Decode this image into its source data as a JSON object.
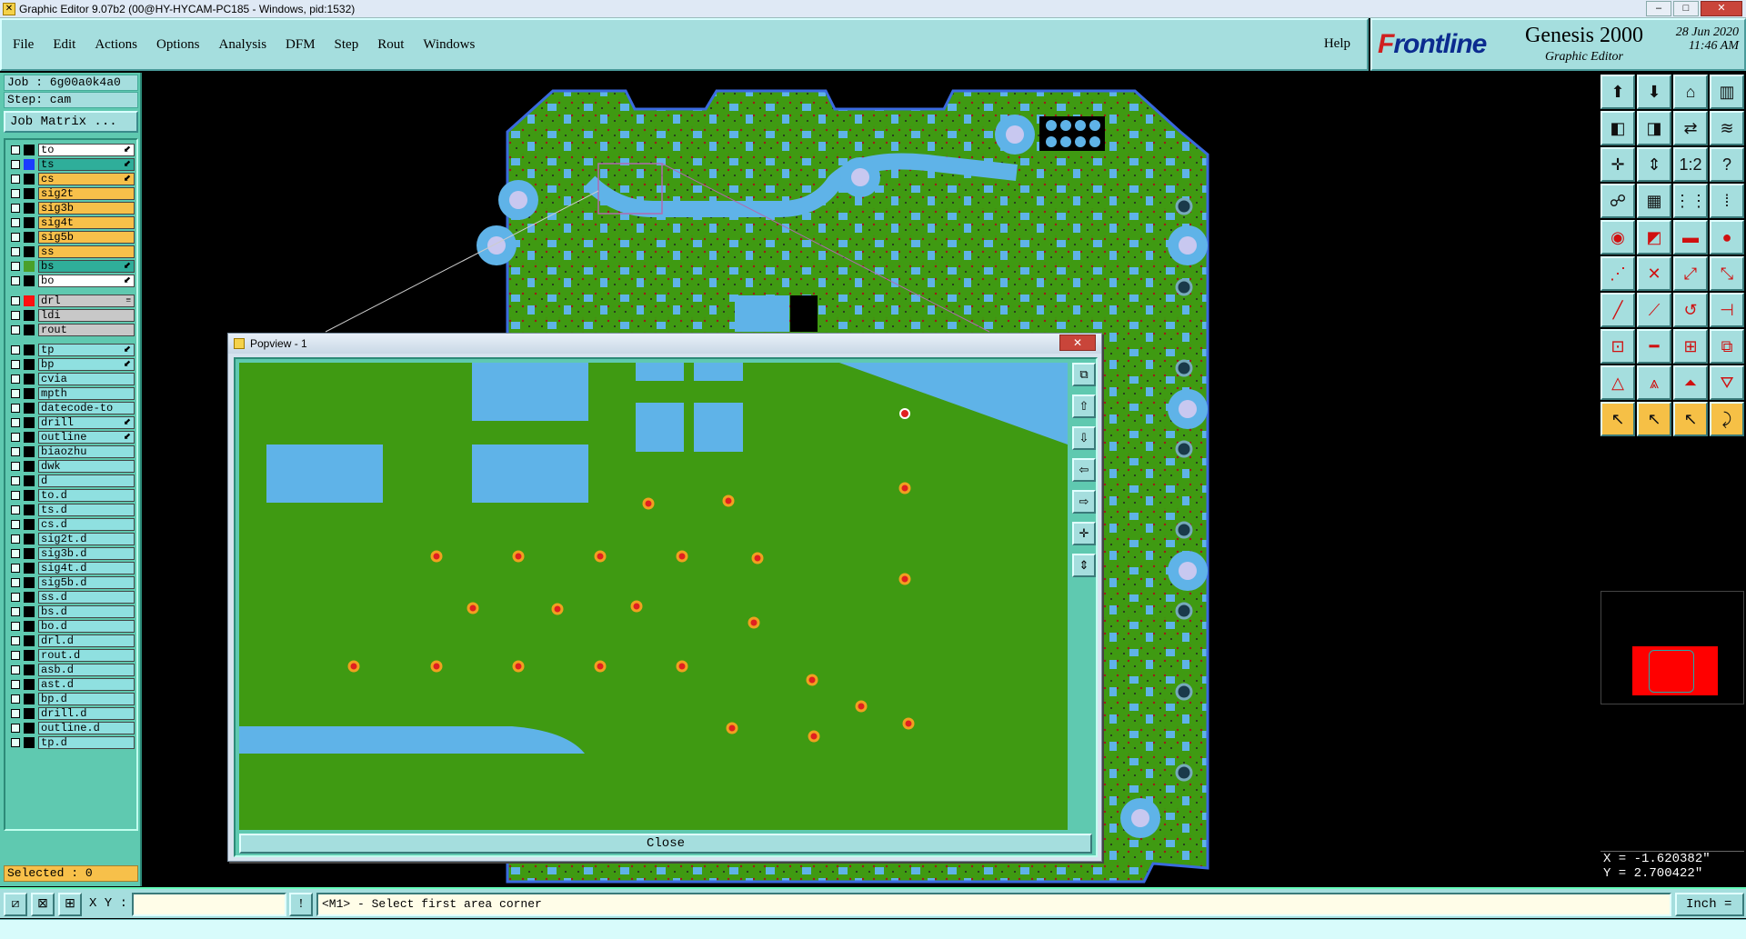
{
  "window": {
    "title": "Graphic Editor 9.07b2 (00@HY-HYCAM-PC185 - Windows, pid:1532)",
    "min": "–",
    "max": "□",
    "close": "✕"
  },
  "menu": {
    "items": [
      "File",
      "Edit",
      "Actions",
      "Options",
      "Analysis",
      "DFM",
      "Step",
      "Rout",
      "Windows"
    ],
    "help": "Help"
  },
  "brand": {
    "logo_prefix": "F",
    "logo_rest": "rontline",
    "product": "Genesis 2000",
    "subtitle": "Graphic Editor",
    "date": "28 Jun 2020",
    "time": "11:46 AM"
  },
  "job": {
    "job_line": "Job : 6g00a0k4a0",
    "step_line": "Step: cam",
    "matrix_button": "Job Matrix ..."
  },
  "layers": [
    {
      "name": "to",
      "color": "#ffffff",
      "sw": "#000000",
      "mark": "⬋"
    },
    {
      "name": "ts",
      "color": "#2fae9a",
      "sw": "#1a3cff",
      "mark": "⬋"
    },
    {
      "name": "cs",
      "color": "#f7c04a",
      "sw": "#000000",
      "mark": "⬋"
    },
    {
      "name": "sig2t",
      "color": "#f7c04a",
      "sw": "#000000",
      "mark": ""
    },
    {
      "name": "sig3b",
      "color": "#f7c04a",
      "sw": "#000000",
      "mark": ""
    },
    {
      "name": "sig4t",
      "color": "#f7c04a",
      "sw": "#000000",
      "mark": ""
    },
    {
      "name": "sig5b",
      "color": "#f7c04a",
      "sw": "#000000",
      "mark": ""
    },
    {
      "name": "ss",
      "color": "#f7c04a",
      "sw": "#000000",
      "mark": ""
    },
    {
      "name": "bs",
      "color": "#2fae9a",
      "sw": "#4aa02a",
      "mark": "⬋"
    },
    {
      "name": "bo",
      "color": "#ffffff",
      "sw": "#000000",
      "mark": "⬋"
    },
    {
      "gap": true
    },
    {
      "name": "drl",
      "color": "#c8c8c8",
      "sw": "#ff1010",
      "mark": "≡"
    },
    {
      "name": "ldi",
      "color": "#c8c8c8",
      "sw": "#000000",
      "mark": ""
    },
    {
      "name": "rout",
      "color": "#c8c8c8",
      "sw": "#000000",
      "mark": ""
    },
    {
      "gap": true
    },
    {
      "name": "tp",
      "color": "#8fe0e0",
      "sw": "#000000",
      "mark": "⬋"
    },
    {
      "name": "bp",
      "color": "#8fe0e0",
      "sw": "#000000",
      "mark": "⬋"
    },
    {
      "name": "cvia",
      "color": "#8fe0e0",
      "sw": "#000000",
      "mark": ""
    },
    {
      "name": "mpth",
      "color": "#8fe0e0",
      "sw": "#000000",
      "mark": ""
    },
    {
      "name": "datecode-to",
      "color": "#8fe0e0",
      "sw": "#000000",
      "mark": ""
    },
    {
      "name": "drill",
      "color": "#8fe0e0",
      "sw": "#000000",
      "mark": "⬋"
    },
    {
      "name": "outline",
      "color": "#8fe0e0",
      "sw": "#000000",
      "mark": "⬋"
    },
    {
      "name": "biaozhu",
      "color": "#8fe0e0",
      "sw": "#000000",
      "mark": ""
    },
    {
      "name": "dwk",
      "color": "#8fe0e0",
      "sw": "#000000",
      "mark": ""
    },
    {
      "name": "d",
      "color": "#8fe0e0",
      "sw": "#000000",
      "mark": ""
    },
    {
      "name": "to.d",
      "color": "#8fe0e0",
      "sw": "#000000",
      "mark": ""
    },
    {
      "name": "ts.d",
      "color": "#8fe0e0",
      "sw": "#000000",
      "mark": ""
    },
    {
      "name": "cs.d",
      "color": "#8fe0e0",
      "sw": "#000000",
      "mark": ""
    },
    {
      "name": "sig2t.d",
      "color": "#8fe0e0",
      "sw": "#000000",
      "mark": ""
    },
    {
      "name": "sig3b.d",
      "color": "#8fe0e0",
      "sw": "#000000",
      "mark": ""
    },
    {
      "name": "sig4t.d",
      "color": "#8fe0e0",
      "sw": "#000000",
      "mark": ""
    },
    {
      "name": "sig5b.d",
      "color": "#8fe0e0",
      "sw": "#000000",
      "mark": ""
    },
    {
      "name": "ss.d",
      "color": "#8fe0e0",
      "sw": "#000000",
      "mark": ""
    },
    {
      "name": "bs.d",
      "color": "#8fe0e0",
      "sw": "#000000",
      "mark": ""
    },
    {
      "name": "bo.d",
      "color": "#8fe0e0",
      "sw": "#000000",
      "mark": ""
    },
    {
      "name": "drl.d",
      "color": "#8fe0e0",
      "sw": "#000000",
      "mark": ""
    },
    {
      "name": "rout.d",
      "color": "#8fe0e0",
      "sw": "#000000",
      "mark": ""
    },
    {
      "name": "asb.d",
      "color": "#8fe0e0",
      "sw": "#000000",
      "mark": ""
    },
    {
      "name": "ast.d",
      "color": "#8fe0e0",
      "sw": "#000000",
      "mark": ""
    },
    {
      "name": "bp.d",
      "color": "#8fe0e0",
      "sw": "#000000",
      "mark": ""
    },
    {
      "name": "drill.d",
      "color": "#8fe0e0",
      "sw": "#000000",
      "mark": ""
    },
    {
      "name": "outline.d",
      "color": "#8fe0e0",
      "sw": "#000000",
      "mark": ""
    },
    {
      "name": "tp.d",
      "color": "#8fe0e0",
      "sw": "#000000",
      "mark": ""
    }
  ],
  "selected": "Selected : 0",
  "toolbar": {
    "rows": [
      [
        {
          "g": "⬆",
          "n": "zoom-in-icon"
        },
        {
          "g": "⬇",
          "n": "zoom-out-icon"
        },
        {
          "g": "⌂",
          "n": "home-icon"
        },
        {
          "g": "▥",
          "n": "home-view-icon"
        }
      ],
      [
        {
          "g": "◧",
          "n": "pan-left-icon"
        },
        {
          "g": "◨",
          "n": "pan-right-icon"
        },
        {
          "g": "⇄",
          "n": "swap-icon"
        },
        {
          "g": "≋",
          "n": "redraw-icon"
        }
      ],
      [
        {
          "g": "✛",
          "n": "fit-icon"
        },
        {
          "g": "⇕",
          "n": "center-icon"
        },
        {
          "g": "1:2",
          "n": "ratio-icon"
        },
        {
          "g": "?",
          "n": "query-icon"
        }
      ],
      [
        {
          "g": "☍",
          "n": "measure-icon"
        },
        {
          "g": "▦",
          "n": "grid-icon"
        },
        {
          "g": "⋮⋮",
          "n": "snap-icon"
        },
        {
          "g": "⁞",
          "n": "layers-icon"
        }
      ],
      [
        {
          "g": "◉",
          "n": "pad-icon"
        },
        {
          "g": "◩",
          "n": "surface-icon"
        },
        {
          "g": "▬",
          "n": "line-icon"
        },
        {
          "g": "●",
          "n": "dot-icon"
        }
      ],
      [
        {
          "g": "⋰",
          "n": "connect-icon"
        },
        {
          "g": "✕",
          "n": "cross-icon"
        },
        {
          "g": "⤢",
          "n": "diagonal-icon"
        },
        {
          "g": "⤡",
          "n": "diagonal2-icon"
        }
      ],
      [
        {
          "g": "╱",
          "n": "slash-icon"
        },
        {
          "g": "⟋",
          "n": "slash2-icon"
        },
        {
          "g": "↺",
          "n": "rotate-icon"
        },
        {
          "g": "⊣",
          "n": "align-icon"
        }
      ],
      [
        {
          "g": "⊡",
          "n": "box-icon"
        },
        {
          "g": "━",
          "n": "hline-icon"
        },
        {
          "g": "⊞",
          "n": "array-icon"
        },
        {
          "g": "⧉",
          "n": "copy-icon"
        }
      ],
      [
        {
          "g": "△",
          "n": "triangle-icon"
        },
        {
          "g": "⩓",
          "n": "triangle2-icon"
        },
        {
          "g": "⏶",
          "n": "triangle3-icon"
        },
        {
          "g": "⛛",
          "n": "triangle4-icon"
        }
      ],
      [
        {
          "g": "↖",
          "n": "select-icon"
        },
        {
          "g": "↖",
          "n": "select2-icon"
        },
        {
          "g": "↖",
          "n": "select3-icon"
        },
        {
          "g": "⤸",
          "n": "select4-icon"
        }
      ]
    ]
  },
  "coords": {
    "x": "X = -1.620382\"",
    "y": "Y = 2.700422\""
  },
  "status": {
    "xy_label": "X Y :",
    "xy_value": "",
    "prompt": "<M1> - Select first area corner",
    "units": "Inch ="
  },
  "popview": {
    "title": "Popview - 1",
    "close_button": "Close",
    "close_x": "✕"
  }
}
